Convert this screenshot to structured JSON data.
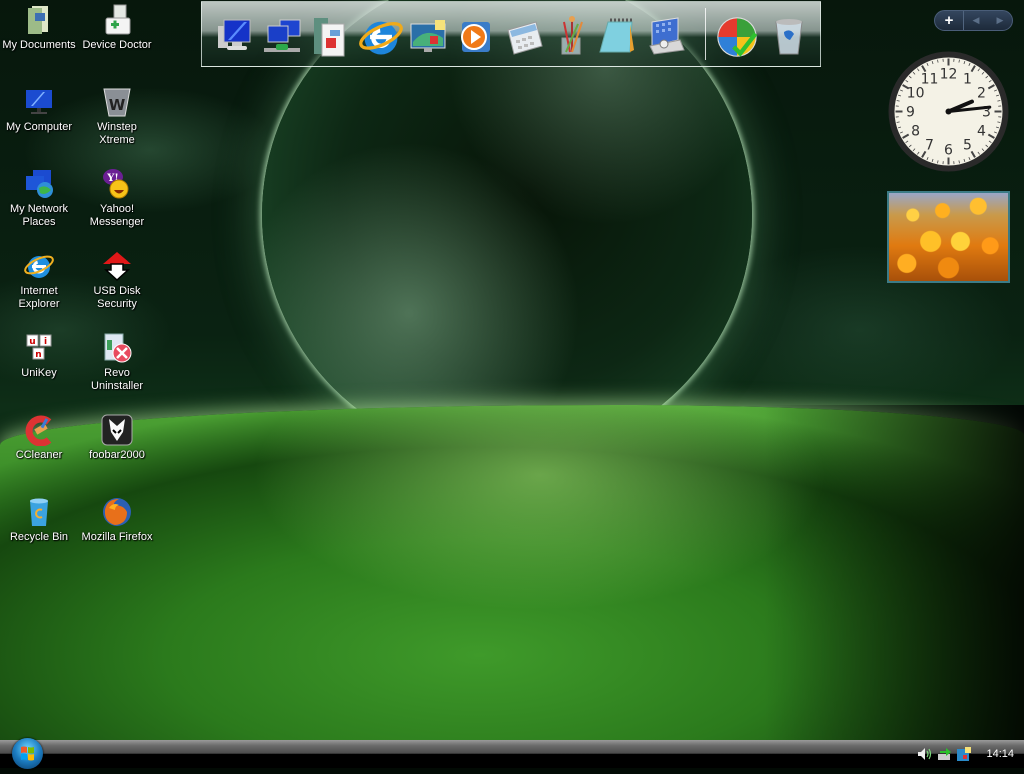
{
  "desktop": {
    "icons": [
      {
        "label": "My Documents",
        "icon": "documents-folder-icon"
      },
      {
        "label": "Device Doctor",
        "icon": "device-doctor-icon"
      },
      {
        "label": "My Computer",
        "icon": "computer-icon"
      },
      {
        "label": "Winstep Xtreme",
        "icon": "winstep-icon"
      },
      {
        "label": "My Network\nPlaces",
        "icon": "network-places-icon"
      },
      {
        "label": "Yahoo!\nMessenger",
        "icon": "yahoo-messenger-icon"
      },
      {
        "label": "Internet\nExplorer",
        "icon": "internet-explorer-icon"
      },
      {
        "label": "USB Disk\nSecurity",
        "icon": "usb-disk-security-icon"
      },
      {
        "label": "UniKey",
        "icon": "unikey-icon"
      },
      {
        "label": "Revo\nUninstaller",
        "icon": "revo-uninstaller-icon"
      },
      {
        "label": "CCleaner",
        "icon": "ccleaner-icon"
      },
      {
        "label": "foobar2000",
        "icon": "foobar2000-icon"
      },
      {
        "label": "Recycle Bin",
        "icon": "recycle-bin-icon"
      },
      {
        "label": "Mozilla Firefox",
        "icon": "firefox-icon"
      }
    ]
  },
  "dock": {
    "items": [
      {
        "name": "my-computer",
        "icon": "computer-icon"
      },
      {
        "name": "network",
        "icon": "network-icon"
      },
      {
        "name": "documents",
        "icon": "documents-icon"
      },
      {
        "name": "internet-explorer",
        "icon": "internet-explorer-icon"
      },
      {
        "name": "display-settings",
        "icon": "display-icon"
      },
      {
        "name": "media-player",
        "icon": "media-player-icon"
      },
      {
        "name": "calculator",
        "icon": "calculator-icon"
      },
      {
        "name": "paint",
        "icon": "paint-brushes-icon"
      },
      {
        "name": "notepad",
        "icon": "notepad-icon"
      },
      {
        "name": "control-panel",
        "icon": "control-panel-icon"
      },
      {
        "name": "windows-update",
        "icon": "windows-update-icon"
      },
      {
        "name": "recycle-bin",
        "icon": "recycle-bin-icon"
      }
    ]
  },
  "gadgets": {
    "add_label": "+",
    "prev_label": "◀",
    "next_label": "▶",
    "clock": {
      "hour": 2,
      "minute": 14,
      "numerals": [
        "12",
        "1",
        "2",
        "3",
        "4",
        "5",
        "6",
        "7",
        "8",
        "9",
        "10",
        "11"
      ]
    }
  },
  "taskbar": {
    "time": "14:14",
    "tray_icons": [
      "volume-icon",
      "network-connection-icon",
      "display-tray-icon"
    ]
  }
}
